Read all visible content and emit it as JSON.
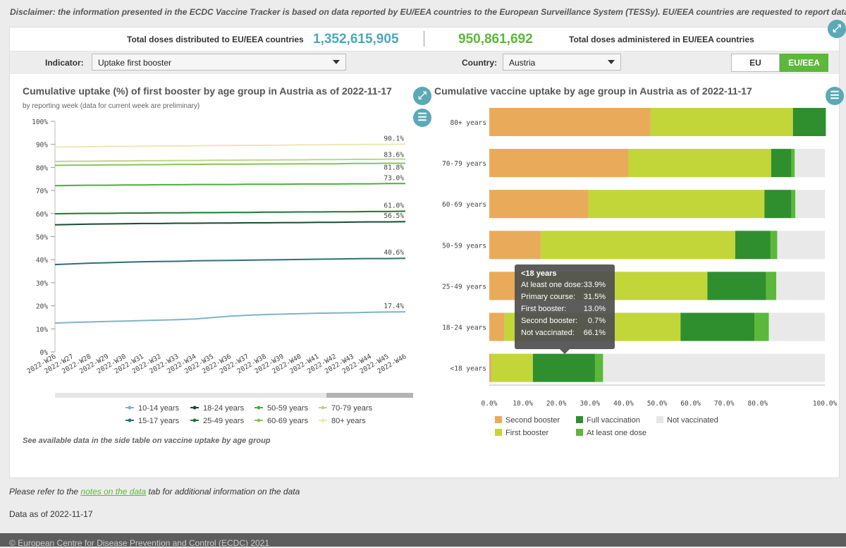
{
  "disclaimer": "Disclaimer: the information presented in the ECDC Vaccine Tracker is based on data reported by EU/EEA countries to the European Surveillance System (TESSy). EU/EEA countries are requested to report data every two weeks o",
  "kpis": {
    "distributed_label": "Total doses distributed to EU/EEA countries",
    "distributed_value": "1,352,615,905",
    "administered_value": "950,861,692",
    "administered_label": "Total doses administered in EU/EEA countries"
  },
  "filters": {
    "indicator_label": "Indicator:",
    "indicator_value": "Uptake first booster",
    "country_label": "Country:",
    "country_value": "Austria",
    "toggle_eu": "EU",
    "toggle_eueea": "EU/EEA"
  },
  "colors": {
    "accent_teal": "#4aa8b8",
    "accent_green": "#5cb83a",
    "second_booster": "#e9ab5a",
    "first_booster": "#c2d63a",
    "full_vaccination": "#2f8f2f",
    "at_least_one_dose": "#5cb83a",
    "not_vaccinated": "#e5e5e5"
  },
  "icons": [
    "expand-icon",
    "menu-icon"
  ],
  "line_chart": {
    "title": "Cumulative uptake (%) of first booster by age group in Austria as of 2022-11-17",
    "subtitle": "by reporting week (data for current week are preliminary)",
    "note": "See available data in the side table on vaccine uptake by age group"
  },
  "bar_chart": {
    "title": "Cumulative vaccine uptake by age group in Austria as of 2022-11-17"
  },
  "tooltip": {
    "title": "<18 years",
    "rows": [
      {
        "label": "At least one dose:",
        "value": "33.9%"
      },
      {
        "label": "Primary course:",
        "value": "31.5%"
      },
      {
        "label": "First booster:",
        "value": "13.0%"
      },
      {
        "label": "Second booster:",
        "value": "0.7%"
      },
      {
        "label": "Not vaccinated:",
        "value": "66.1%"
      }
    ]
  },
  "footer": {
    "refer_prefix": "Please refer to the ",
    "refer_link": "notes on the data",
    "refer_suffix": " tab for additional information on the data",
    "data_as_of": "Data as of 2022-11-17",
    "copyright": "© European Centre for Disease Prevention and Control (ECDC) 2021"
  },
  "chart_data": [
    {
      "type": "line",
      "title": "Cumulative uptake (%) of first booster by age group in Austria as of 2022-11-17",
      "subtitle": "by reporting week (data for current week are preliminary)",
      "x": [
        "2022-W26",
        "2022-W27",
        "2022-W28",
        "2022-W29",
        "2022-W30",
        "2022-W31",
        "2022-W32",
        "2022-W33",
        "2022-W34",
        "2022-W35",
        "2022-W36",
        "2022-W37",
        "2022-W38",
        "2022-W39",
        "2022-W40",
        "2022-W41",
        "2022-W42",
        "2022-W43",
        "2022-W44",
        "2022-W45",
        "2022-W46"
      ],
      "y_ticks": [
        "0%",
        "10%",
        "20%",
        "30%",
        "40%",
        "50%",
        "60%",
        "70%",
        "80%",
        "90%",
        "100%"
      ],
      "ylim": [
        0,
        100
      ],
      "legend_position": "bottom",
      "series": [
        {
          "name": "10-14 years",
          "color": "#7fb3c8",
          "legend_col": 0,
          "legend_row": 0,
          "values": [
            12.5,
            12.8,
            13.0,
            13.2,
            13.4,
            13.6,
            13.8,
            14.0,
            14.3,
            14.9,
            15.5,
            15.9,
            16.2,
            16.4,
            16.6,
            16.8,
            16.9,
            17.0,
            17.2,
            17.3,
            17.4
          ],
          "end_label": "17.4%"
        },
        {
          "name": "15-17 years",
          "color": "#2d6f78",
          "legend_col": 0,
          "legend_row": 1,
          "values": [
            37.9,
            38.2,
            38.5,
            38.7,
            38.9,
            39.1,
            39.2,
            39.3,
            39.5,
            39.6,
            39.7,
            39.8,
            39.9,
            40.0,
            40.1,
            40.2,
            40.3,
            40.4,
            40.5,
            40.5,
            40.6
          ],
          "end_label": "40.6%"
        },
        {
          "name": "18-24 years",
          "color": "#164d2e",
          "legend_col": 1,
          "legend_row": 0,
          "values": [
            55.1,
            55.3,
            55.4,
            55.5,
            55.6,
            55.7,
            55.7,
            55.8,
            55.8,
            55.9,
            55.9,
            56.0,
            56.0,
            56.1,
            56.1,
            56.2,
            56.2,
            56.3,
            56.4,
            56.4,
            56.5
          ],
          "end_label": "56.5%"
        },
        {
          "name": "25-49 years",
          "color": "#1a7a2e",
          "legend_col": 1,
          "legend_row": 1,
          "values": [
            59.9,
            60.0,
            60.1,
            60.1,
            60.2,
            60.2,
            60.3,
            60.3,
            60.4,
            60.4,
            60.5,
            60.5,
            60.6,
            60.6,
            60.7,
            60.7,
            60.8,
            60.8,
            60.9,
            60.9,
            61.0
          ],
          "end_label": "61.0%"
        },
        {
          "name": "50-59 years",
          "color": "#4caf3c",
          "legend_col": 2,
          "legend_row": 0,
          "values": [
            72.1,
            72.2,
            72.3,
            72.3,
            72.4,
            72.4,
            72.5,
            72.5,
            72.6,
            72.6,
            72.6,
            72.7,
            72.7,
            72.7,
            72.8,
            72.8,
            72.8,
            72.9,
            72.9,
            73.0,
            73.0
          ],
          "end_label": "73.0%"
        },
        {
          "name": "60-69 years",
          "color": "#86c45a",
          "legend_col": 2,
          "legend_row": 1,
          "values": [
            80.9,
            81.0,
            81.0,
            81.1,
            81.1,
            81.2,
            81.2,
            81.3,
            81.3,
            81.4,
            81.4,
            81.4,
            81.5,
            81.5,
            81.6,
            81.6,
            81.6,
            81.7,
            81.7,
            81.8,
            81.8
          ],
          "end_label": "81.8%"
        },
        {
          "name": "70-79 years",
          "color": "#bcd68c",
          "legend_col": 3,
          "legend_row": 0,
          "values": [
            82.6,
            82.7,
            82.7,
            82.8,
            82.8,
            82.9,
            82.9,
            83.0,
            83.0,
            83.1,
            83.1,
            83.2,
            83.2,
            83.3,
            83.3,
            83.4,
            83.4,
            83.5,
            83.5,
            83.6,
            83.6
          ],
          "end_label": "83.6%"
        },
        {
          "name": "80+ years",
          "color": "#ebe7b4",
          "legend_col": 3,
          "legend_row": 1,
          "values": [
            88.8,
            88.9,
            89.0,
            89.1,
            89.1,
            89.2,
            89.3,
            89.3,
            89.4,
            89.5,
            89.5,
            89.6,
            89.6,
            89.7,
            89.8,
            89.8,
            89.9,
            89.9,
            90.0,
            90.0,
            90.1
          ],
          "end_label": "90.1%"
        }
      ]
    },
    {
      "type": "bar",
      "orientation": "horizontal",
      "stacked": true,
      "title": "Cumulative vaccine uptake by age group in Austria as of 2022-11-17",
      "categories": [
        "80+ years",
        "70-79 years",
        "60-69 years",
        "50-59 years",
        "25-49 years",
        "18-24 years",
        "<18 years"
      ],
      "x_ticks": [
        "0.0%",
        "10.0%",
        "20.0%",
        "30.0%",
        "40.0%",
        "50.0%",
        "60.0%",
        "70.0%",
        "80.0%",
        "100.0%"
      ],
      "xlim": [
        0,
        100
      ],
      "legend_position": "bottom",
      "series": [
        {
          "name": "Second booster",
          "color": "#e9ab5a",
          "values": [
            48.0,
            41.5,
            29.5,
            15.3,
            8.5,
            4.5,
            0.7
          ]
        },
        {
          "name": "First booster",
          "color": "#c2d63a",
          "values": [
            42.5,
            42.5,
            52.5,
            58.0,
            56.5,
            52.5,
            12.3
          ]
        },
        {
          "name": "Full vaccination",
          "color": "#2f8f2f",
          "values": [
            9.8,
            6.0,
            8.0,
            10.5,
            17.5,
            22.0,
            18.5
          ]
        },
        {
          "name": "At least one dose",
          "color": "#5cb83a",
          "values": [
            0,
            1.0,
            1.2,
            2.0,
            3.0,
            4.3,
            2.4
          ]
        },
        {
          "name": "Not vaccinated",
          "color": "#e5e5e5",
          "values": [
            0,
            9.0,
            8.8,
            14.2,
            14.5,
            16.7,
            66.1
          ]
        }
      ]
    }
  ]
}
